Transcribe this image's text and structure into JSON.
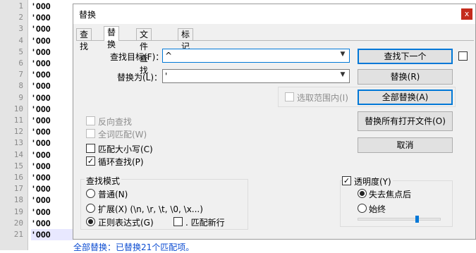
{
  "editor": {
    "line_numbers": [
      "1",
      "2",
      "3",
      "4",
      "5",
      "6",
      "7",
      "8",
      "9",
      "10",
      "11",
      "12",
      "13",
      "14",
      "15",
      "16",
      "17",
      "18",
      "19",
      "20",
      "21"
    ],
    "lines": [
      "'OOO",
      "'OOO",
      "'OOO",
      "'OOO",
      "'OOO",
      "'OOO",
      "'OOO",
      "'OOO",
      "'OOO",
      "'OOO",
      "'OOO",
      "'OOO",
      "'OOO",
      "'OOO",
      "'OOO",
      "'OOO",
      "'OOO",
      "'OOO",
      "'OOO",
      "'OOO",
      "'OOO"
    ]
  },
  "dialog": {
    "title": "替换",
    "close_glyph": "x",
    "tabs": [
      {
        "label": "查找"
      },
      {
        "label": "替换"
      },
      {
        "label": "文件查找"
      },
      {
        "label": "标记"
      }
    ],
    "find_label": "查找目标(F)：",
    "find_value": "^",
    "replace_label": "替换为(L)：",
    "replace_value": "'",
    "scope_checkbox": "选取范围内(I)",
    "buttons": {
      "find_next": "查找下一个",
      "replace": "替换(R)",
      "replace_all": "全部替换(A)",
      "replace_all_open": "替换所有打开文件(O)",
      "cancel": "取消"
    },
    "options": {
      "reverse": "反向查找",
      "whole_word": "全词匹配(W)",
      "match_case": "匹配大小写(C)",
      "wrap": "循环查找(P)"
    },
    "search_mode": {
      "label": "查找模式",
      "normal": "普通(N)",
      "extended": "扩展(X) (\\n, \\r, \\t, \\0, \\x...)",
      "regex": "正则表达式(G)",
      "dot_newline": ". 匹配新行"
    },
    "transparency": {
      "label": "透明度(Y)",
      "on_lose_focus": "失去焦点后",
      "always": "始终"
    },
    "status": "全部替换：已替换21个匹配项。"
  }
}
